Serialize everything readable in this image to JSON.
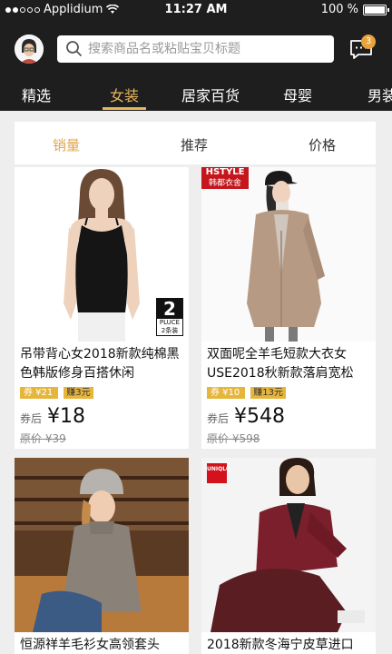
{
  "status_bar": {
    "carrier": "Applidium",
    "time": "11:27 AM",
    "battery": "100 %"
  },
  "header": {
    "search_placeholder": "搜索商品名或粘贴宝贝标题",
    "message_badge": "3",
    "icons": {
      "search": "search-icon",
      "messages": "chat-icon",
      "avatar": "user-avatar"
    }
  },
  "category_tabs": [
    {
      "label": "精选",
      "active": false
    },
    {
      "label": "女装",
      "active": true
    },
    {
      "label": "居家百货",
      "active": false
    },
    {
      "label": "母婴",
      "active": false
    },
    {
      "label": "男装",
      "active": false
    }
  ],
  "sort_tabs": [
    {
      "label": "销量",
      "active": true
    },
    {
      "label": "推荐",
      "active": false
    },
    {
      "label": "价格",
      "active": false
    }
  ],
  "products": [
    {
      "title": "吊带背心女2018新款纯棉黑色韩版修身百搭休闲",
      "coupon": "券 ¥21",
      "earn": "赚3元",
      "after_label": "券后",
      "price": "¥18",
      "original_price": "原价 ¥39",
      "badge_number": "2",
      "badge_sub_top": "PLUCE",
      "badge_sub": "2条装"
    },
    {
      "title": "双面呢全羊毛短款大衣女USE2018秋新款落肩宽松",
      "coupon": "券 ¥10",
      "earn": "赚13元",
      "after_label": "券后",
      "price": "¥548",
      "original_price": "原价 ¥598",
      "brand_logo_top": "HSTYLE",
      "brand_logo_bottom": "韩都衣舍"
    },
    {
      "title": "恒源祥羊毛衫女高领套头"
    },
    {
      "title": "2018新款冬海宁皮草进口",
      "brand_logo": "UNIQLO"
    }
  ],
  "colors": {
    "header_bg": "#1e1e1e",
    "accent": "#e7b55a",
    "coupon": "#e6b53c"
  }
}
